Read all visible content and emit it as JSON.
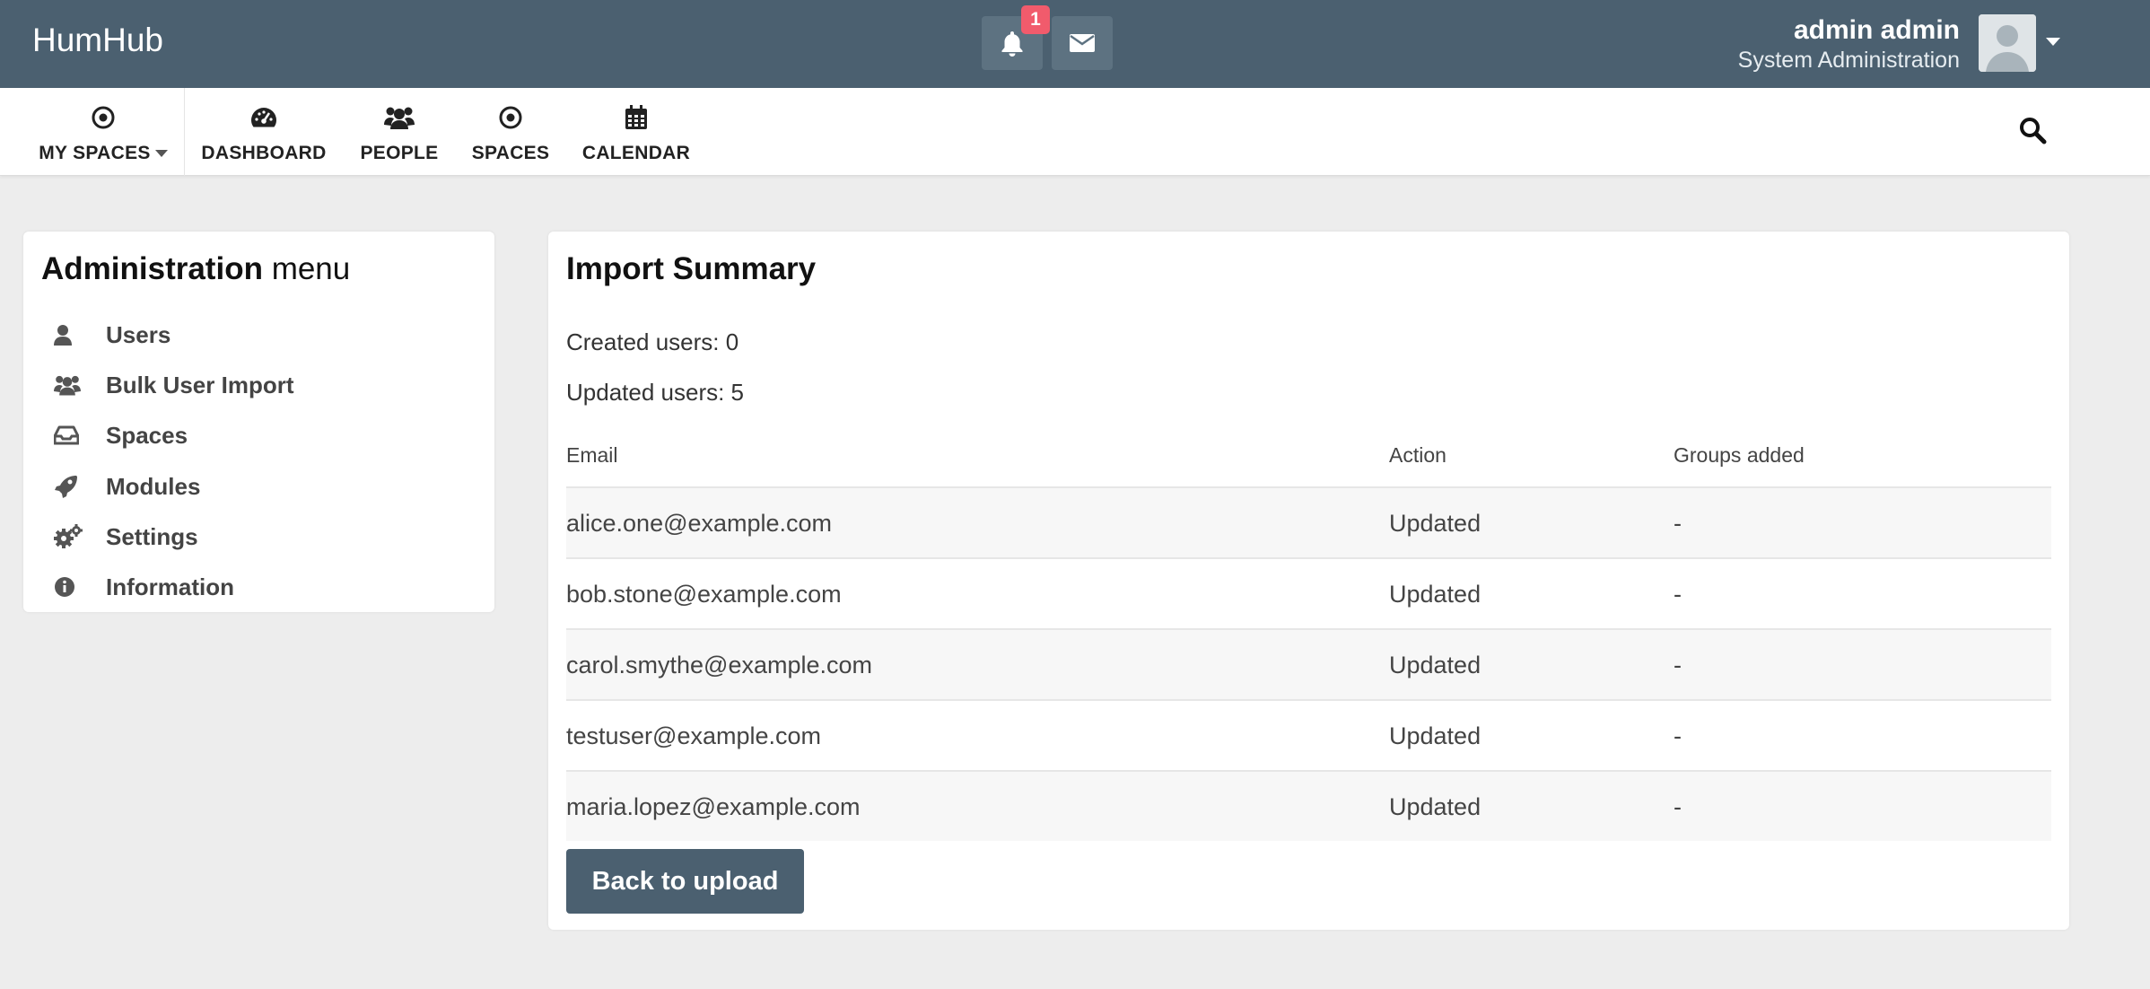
{
  "topbar": {
    "brand": "HumHub",
    "notification_count": "1",
    "user_name": "admin admin",
    "user_role": "System Administration"
  },
  "nav": {
    "items": [
      {
        "label": "MY SPACES",
        "icon": "dot-circle-icon"
      },
      {
        "label": "DASHBOARD",
        "icon": "tachometer-icon"
      },
      {
        "label": "PEOPLE",
        "icon": "users-icon"
      },
      {
        "label": "SPACES",
        "icon": "dot-circle-icon"
      },
      {
        "label": "CALENDAR",
        "icon": "calendar-icon"
      }
    ]
  },
  "admin_menu": {
    "title_bold": "Administration",
    "title_light": "menu",
    "items": [
      {
        "label": "Users",
        "icon": "user-icon"
      },
      {
        "label": "Bulk User Import",
        "icon": "users-icon"
      },
      {
        "label": "Spaces",
        "icon": "inbox-icon"
      },
      {
        "label": "Modules",
        "icon": "rocket-icon"
      },
      {
        "label": "Settings",
        "icon": "cogs-icon"
      },
      {
        "label": "Information",
        "icon": "info-circle-icon"
      }
    ]
  },
  "summary": {
    "title": "Import Summary",
    "created": "Created users: 0",
    "updated": "Updated users: 5",
    "columns": [
      "Email",
      "Action",
      "Groups added"
    ],
    "rows": [
      {
        "email": "alice.one@example.com",
        "action": "Updated",
        "groups": "-"
      },
      {
        "email": "bob.stone@example.com",
        "action": "Updated",
        "groups": "-"
      },
      {
        "email": "carol.smythe@example.com",
        "action": "Updated",
        "groups": "-"
      },
      {
        "email": "testuser@example.com",
        "action": "Updated",
        "groups": "-"
      },
      {
        "email": "maria.lopez@example.com",
        "action": "Updated",
        "groups": "-"
      }
    ],
    "back_label": "Back to upload"
  },
  "colors": {
    "topbar": "#4b6070",
    "badge": "#f15b6c",
    "background": "#ededed"
  }
}
